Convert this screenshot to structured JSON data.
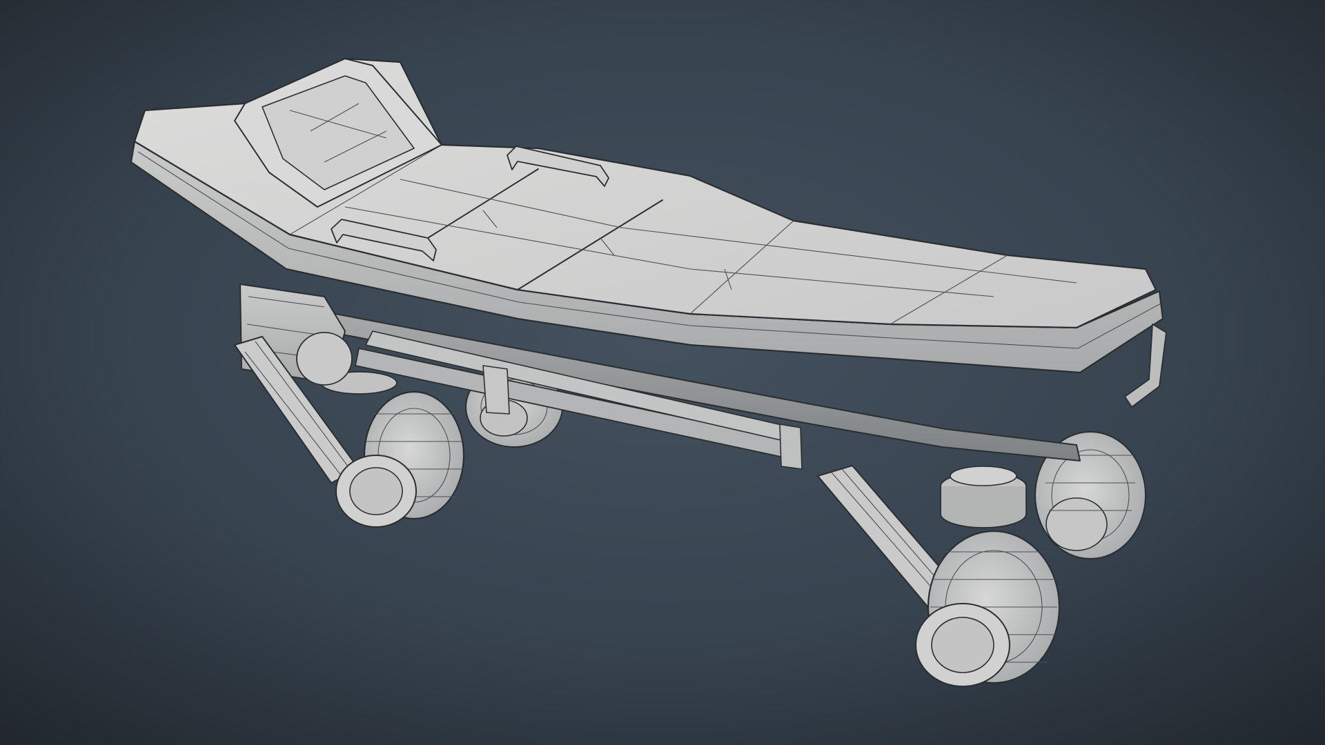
{
  "scene": {
    "subject": "stretcher-wireframe-render",
    "render_style": "clay-wireframe-overlay",
    "colors": {
      "background_center": "#3f4b57",
      "background_edge": "#232a31",
      "clay_light": "#d2d3d2",
      "clay_mid": "#b9bbba",
      "clay_dark": "#8e9193",
      "wire": "#2a2e31"
    },
    "parts": {
      "mattress": "mattress",
      "backrest": "backrest",
      "handles": "side-handle",
      "frame": "lower-frame",
      "legs": "leg",
      "wheels": "caster-wheel"
    }
  }
}
